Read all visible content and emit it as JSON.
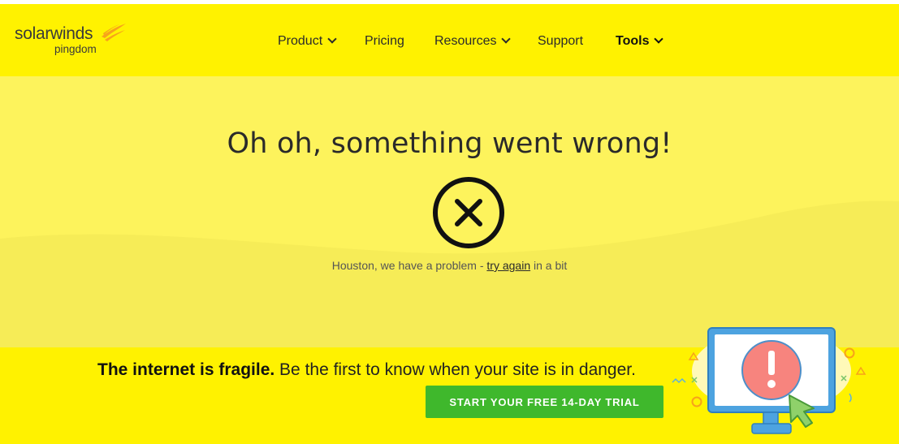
{
  "brand": {
    "name": "solarwinds",
    "product": "pingdom",
    "accent": "#f7a21b"
  },
  "nav": {
    "items": [
      {
        "label": "Product",
        "dropdown": true
      },
      {
        "label": "Pricing",
        "dropdown": false
      },
      {
        "label": "Resources",
        "dropdown": true
      },
      {
        "label": "Support",
        "dropdown": false
      },
      {
        "label": "Tools",
        "dropdown": true,
        "active": true
      }
    ]
  },
  "error": {
    "headline": "Oh oh, something went wrong!",
    "icon": "close-circle-icon",
    "message_before": "Houston, we have a problem - ",
    "link_label": "try again",
    "message_after": " in a bit"
  },
  "promo": {
    "bold": "The internet is fragile.",
    "text": " Be the first to know when your site is in danger.",
    "cta_label": "START YOUR FREE 14-DAY TRIAL",
    "illustration": "monitor-alert-icon"
  },
  "colors": {
    "nav_bg": "#fff200",
    "hero_bg": "#fdf35c",
    "cta_bg": "#3fb82c"
  }
}
